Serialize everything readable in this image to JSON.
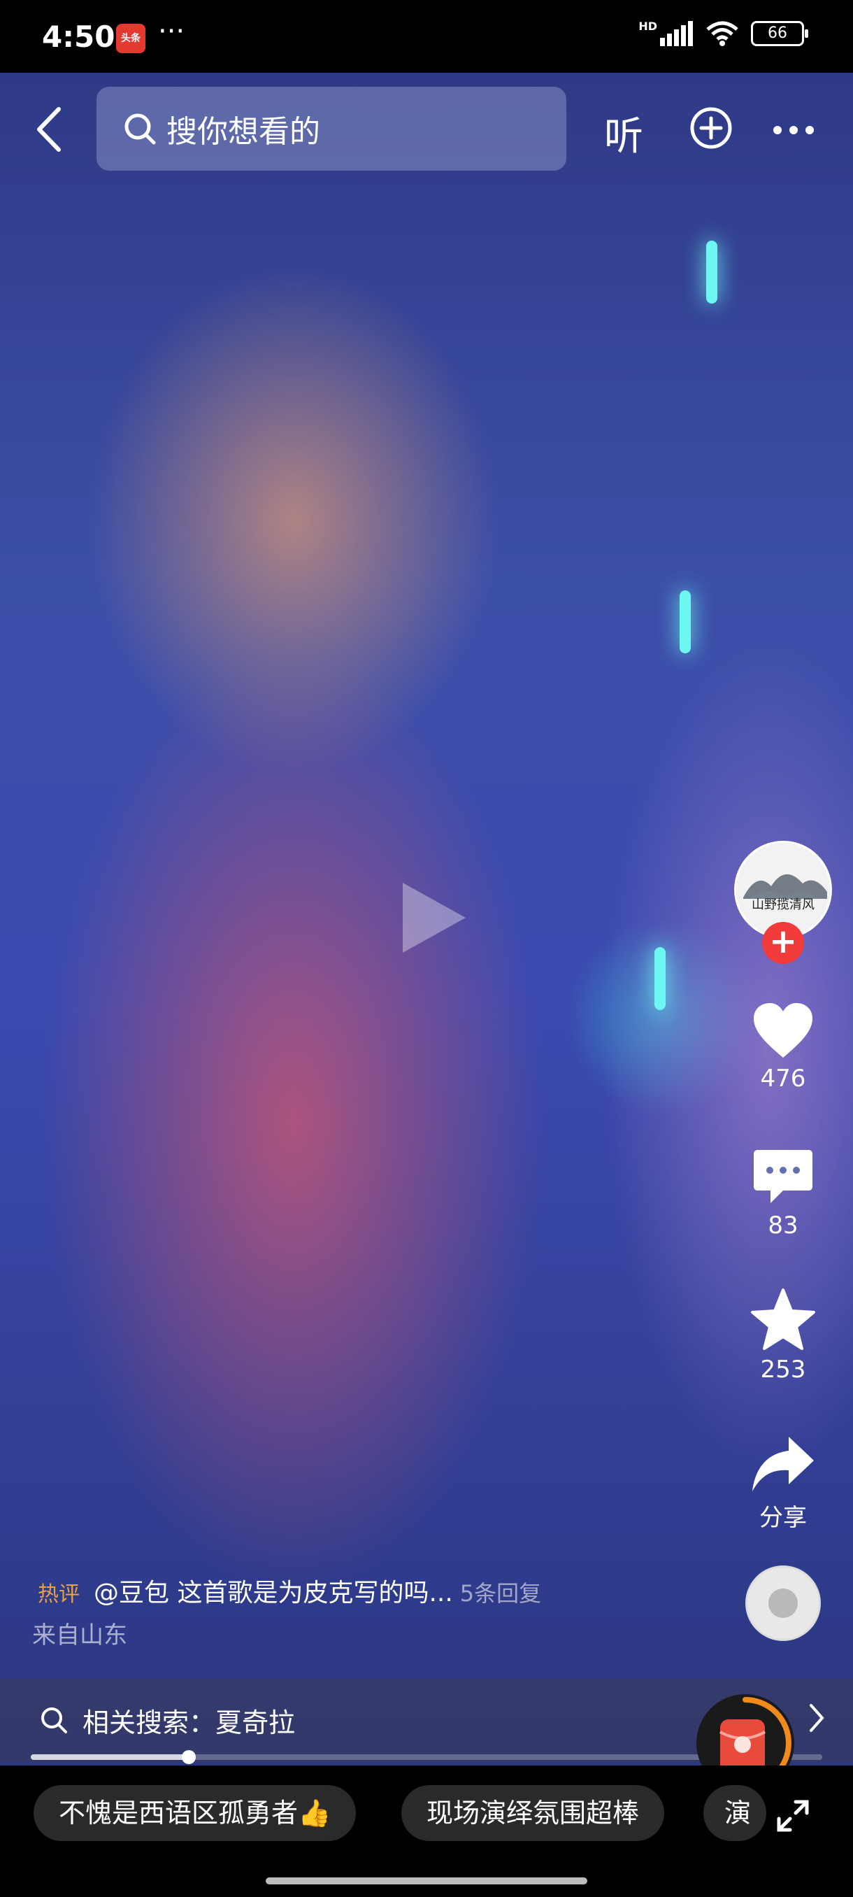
{
  "status_bar": {
    "time": "4:50",
    "app_badge": "头条",
    "more": "···",
    "network": "HD",
    "battery": "66"
  },
  "top_nav": {
    "search_placeholder": "搜你想看的",
    "listen_label": "听"
  },
  "creator": {
    "avatar_text": "山野揽清风"
  },
  "actions": {
    "likes": "476",
    "comments": "83",
    "favorites": "253",
    "share": "分享"
  },
  "hot_comment": {
    "tag": "热评",
    "text": "@豆包 这首歌是为皮克写的吗...",
    "replies": "5条回复",
    "location": "来自山东"
  },
  "related_search": {
    "text": "相关搜索：夏奇拉"
  },
  "playback": {
    "progress": 0.2
  },
  "chips": [
    "不愧是西语区孤勇者👍",
    "现场演绎氛围超棒",
    "演"
  ],
  "colors": {
    "follow": "#f23b3b",
    "hot_tag": "#e4a243",
    "redpacket": "#e84a3c",
    "redpacket_ring": "#f28a1b"
  }
}
